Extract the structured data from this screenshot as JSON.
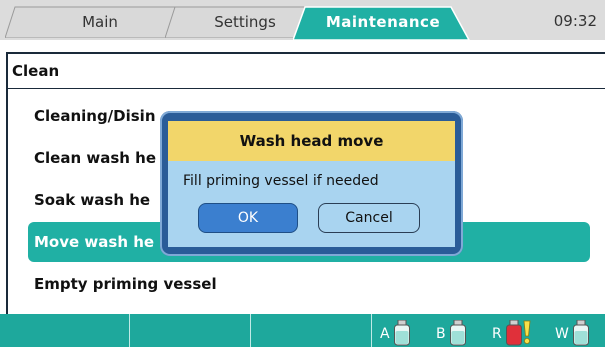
{
  "tabs": [
    {
      "label": "Main",
      "active": false
    },
    {
      "label": "Settings",
      "active": false
    },
    {
      "label": "Maintenance",
      "active": true
    }
  ],
  "clock": "09:32",
  "panel": {
    "title": "Clean",
    "items": [
      {
        "label": "Cleaning/Disin",
        "selected": false
      },
      {
        "label": "Clean wash he",
        "selected": false
      },
      {
        "label": "Soak wash he",
        "selected": false
      },
      {
        "label": "Move wash he",
        "selected": true
      },
      {
        "label": "Empty priming vessel",
        "selected": false
      }
    ]
  },
  "dialog": {
    "title": "Wash head move",
    "message": "Fill priming vessel if needed",
    "ok_label": "OK",
    "cancel_label": "Cancel"
  },
  "status": {
    "indicators": [
      {
        "letter": "A",
        "bottle_color": "#9fe0d8",
        "icon": "bottle-icon"
      },
      {
        "letter": "B",
        "bottle_color": "#9fe0d8",
        "icon": "bottle-icon"
      },
      {
        "letter": "R",
        "bottle_color": "#e0303a",
        "icon": "bottle-warning-icon"
      },
      {
        "letter": "W",
        "bottle_color": "#9fe0d8",
        "icon": "bottle-icon"
      }
    ]
  },
  "colors": {
    "accent": "#20b0a4",
    "dialog_header": "#f2d66a",
    "dialog_body": "#a9d4f0",
    "dialog_frame": "#2a5c98"
  }
}
